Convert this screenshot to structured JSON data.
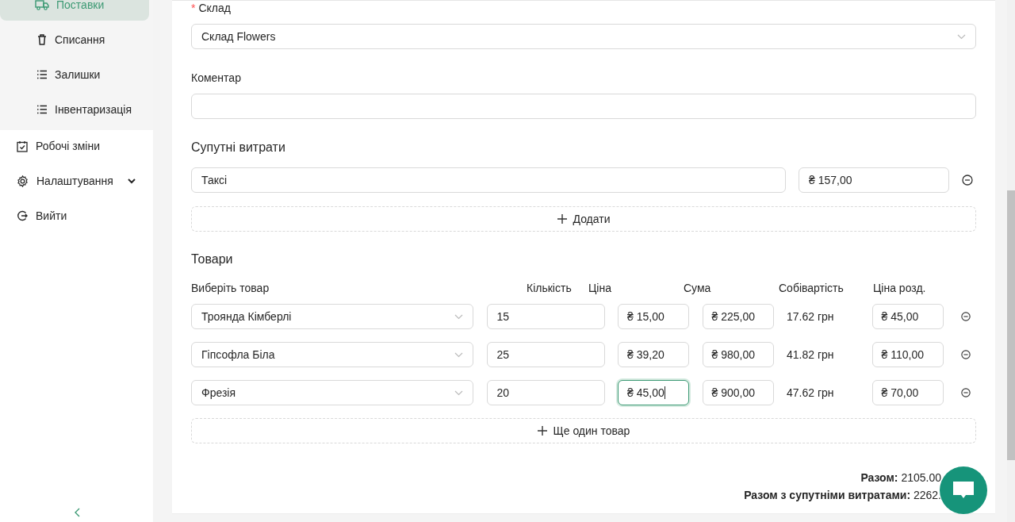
{
  "sidebar": {
    "submenu": [
      {
        "label": "Поставки",
        "kind": "truck",
        "selected": true
      },
      {
        "label": "Списання",
        "kind": "trash",
        "selected": false
      },
      {
        "label": "Залишки",
        "kind": "list",
        "selected": false
      },
      {
        "label": "Інвентаризація",
        "kind": "list",
        "selected": false
      }
    ],
    "menu": [
      {
        "label": "Робочі зміни",
        "kind": "calendar",
        "selected": false
      },
      {
        "label": "Налаштування",
        "kind": "gear",
        "selected": false,
        "expanded": false
      },
      {
        "label": "Вийти",
        "kind": "logout",
        "selected": false
      }
    ]
  },
  "form": {
    "warehouse": {
      "label": "Склад",
      "required_mark": "*",
      "value": "Склад Flowers"
    },
    "comment": {
      "label": "Коментар"
    },
    "expenses_title": "Супутні витрати",
    "expenses": [
      {
        "name": "Таксі",
        "amount": "₴ 157,00"
      }
    ],
    "add_expense": "Додати",
    "goods_title": "Товари",
    "columns": [
      "Виберіть товар",
      "Кількість",
      "Ціна",
      "Сума",
      "Собівартість",
      "Ціна розд."
    ],
    "goods": [
      {
        "product": "Троянда Кімберлі",
        "quantity": "15",
        "price": "₴ 15,00",
        "price_focused": false,
        "sum": "₴ 225,00",
        "cost": "17.62 грн",
        "retail": "₴ 45,00"
      },
      {
        "product": "Гіпсофла Біла",
        "quantity": "25",
        "price": "₴ 39,20",
        "price_focused": false,
        "sum": "₴ 980,00",
        "cost": "41.82 грн",
        "retail": "₴ 110,00"
      },
      {
        "product": "Фрезія",
        "quantity": "20",
        "price": "₴ 45,00",
        "price_focused": true,
        "sum": "₴ 900,00",
        "cost": "47.62 грн",
        "retail": "₴ 70,00"
      }
    ],
    "add_good": "Ще один товар",
    "totals": [
      {
        "label": "Разом:",
        "value": "2105.00"
      },
      {
        "label": "Разом з супутніми витратами:",
        "value": "2262."
      }
    ]
  }
}
